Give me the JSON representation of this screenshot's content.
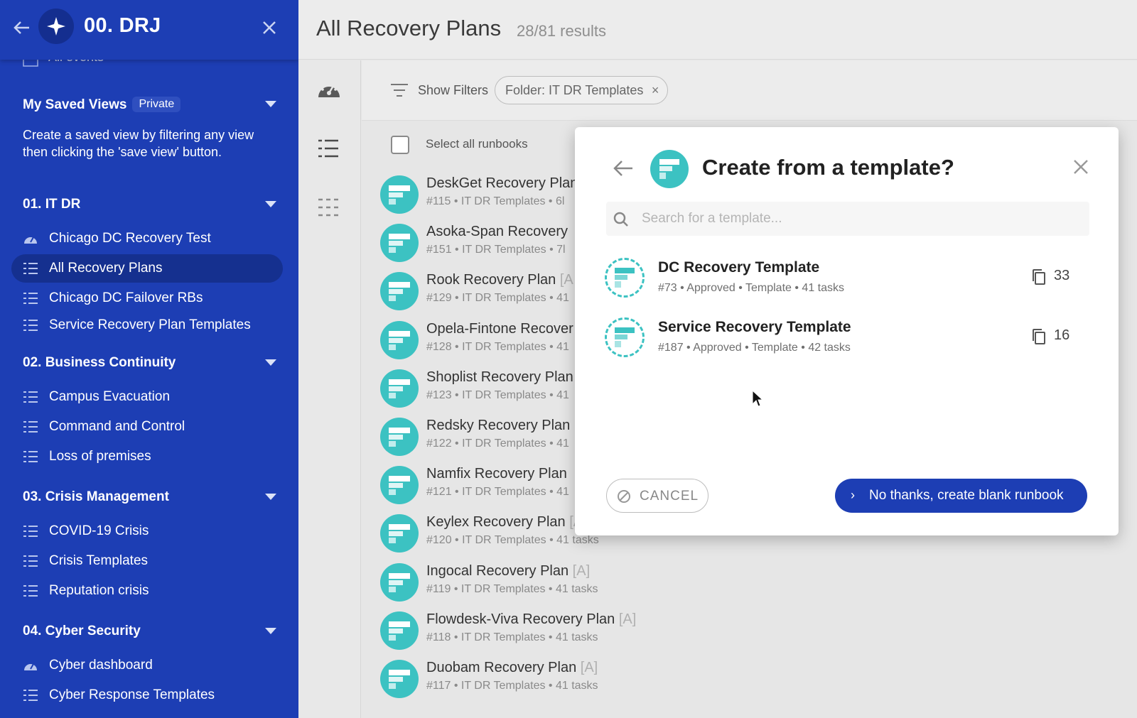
{
  "sidebar": {
    "title": "00. DRJ",
    "partial_item": "All events",
    "saved_views": {
      "title": "My Saved Views",
      "badge": "Private",
      "description": "Create a saved view by filtering any view then clicking the 'save view' button."
    },
    "sections": [
      {
        "title": "01. IT DR",
        "items": [
          {
            "label": "Chicago DC Recovery Test",
            "icon": "dashboard-icon"
          },
          {
            "label": "All Recovery Plans",
            "icon": "list-icon",
            "active": true
          },
          {
            "label": "Chicago DC Failover RBs",
            "icon": "list-icon"
          },
          {
            "label": "Service Recovery Plan Templates",
            "icon": "list-icon"
          }
        ]
      },
      {
        "title": "02. Business Continuity",
        "items": [
          {
            "label": "Campus Evacuation",
            "icon": "list-icon"
          },
          {
            "label": "Command and Control",
            "icon": "list-icon"
          },
          {
            "label": "Loss of premises",
            "icon": "list-icon"
          }
        ]
      },
      {
        "title": "03. Crisis Management",
        "items": [
          {
            "label": "COVID-19 Crisis",
            "icon": "list-icon"
          },
          {
            "label": "Crisis Templates",
            "icon": "list-icon"
          },
          {
            "label": "Reputation crisis",
            "icon": "list-icon"
          }
        ]
      },
      {
        "title": "04. Cyber Security",
        "items": [
          {
            "label": "Cyber dashboard",
            "icon": "dashboard-icon"
          },
          {
            "label": "Cyber Response Templates",
            "icon": "list-icon"
          }
        ]
      }
    ]
  },
  "header": {
    "title": "All Recovery Plans",
    "results": "28/81 results"
  },
  "filters": {
    "show_filters_label": "Show Filters",
    "chip_label": "Folder: IT DR Templates",
    "chip_close": "×"
  },
  "list": {
    "select_all_label": "Select all runbooks",
    "runbooks": [
      {
        "name": "DeskGet Recovery Plan",
        "tag": "",
        "meta": "#115 • IT DR Templates • 6l"
      },
      {
        "name": "Asoka-Span Recovery",
        "tag": "",
        "meta": "#151 • IT DR Templates • 7l"
      },
      {
        "name": "Rook Recovery Plan",
        "tag": "[A",
        "meta": "#129 • IT DR Templates • 41"
      },
      {
        "name": "Opela-Fintone Recover",
        "tag": "",
        "meta": "#128 • IT DR Templates • 41"
      },
      {
        "name": "Shoplist Recovery Plan",
        "tag": "",
        "meta": "#123 • IT DR Templates • 41"
      },
      {
        "name": "Redsky Recovery Plan",
        "tag": "",
        "meta": "#122 • IT DR Templates • 41"
      },
      {
        "name": "Namfix Recovery Plan",
        "tag": "",
        "meta": "#121 • IT DR Templates • 41"
      },
      {
        "name": "Keylex Recovery Plan",
        "tag": "[A]",
        "meta": "#120 • IT DR Templates • 41 tasks"
      },
      {
        "name": "Ingocal Recovery Plan",
        "tag": "[A]",
        "meta": "#119 • IT DR Templates • 41 tasks"
      },
      {
        "name": "Flowdesk-Viva Recovery Plan",
        "tag": "[A]",
        "meta": "#118 • IT DR Templates • 41 tasks"
      },
      {
        "name": "Duobam Recovery Plan",
        "tag": "[A]",
        "meta": "#117 • IT DR Templates • 41 tasks"
      }
    ]
  },
  "modal": {
    "title": "Create from a template?",
    "search_placeholder": "Search for a template...",
    "templates": [
      {
        "name": "DC Recovery Template",
        "meta": "#73 • Approved • Template • 41 tasks",
        "count": "33"
      },
      {
        "name": "Service Recovery Template",
        "meta": "#187 • Approved • Template • 42 tasks",
        "count": "16"
      }
    ],
    "cancel_label": "CANCEL",
    "blank_label": "No thanks, create blank runbook",
    "blank_chevron": "›"
  },
  "colors": {
    "sidebar_bg": "#1d3eb4",
    "accent_teal": "#3cc2c2",
    "primary_button": "#1d3eb4"
  }
}
